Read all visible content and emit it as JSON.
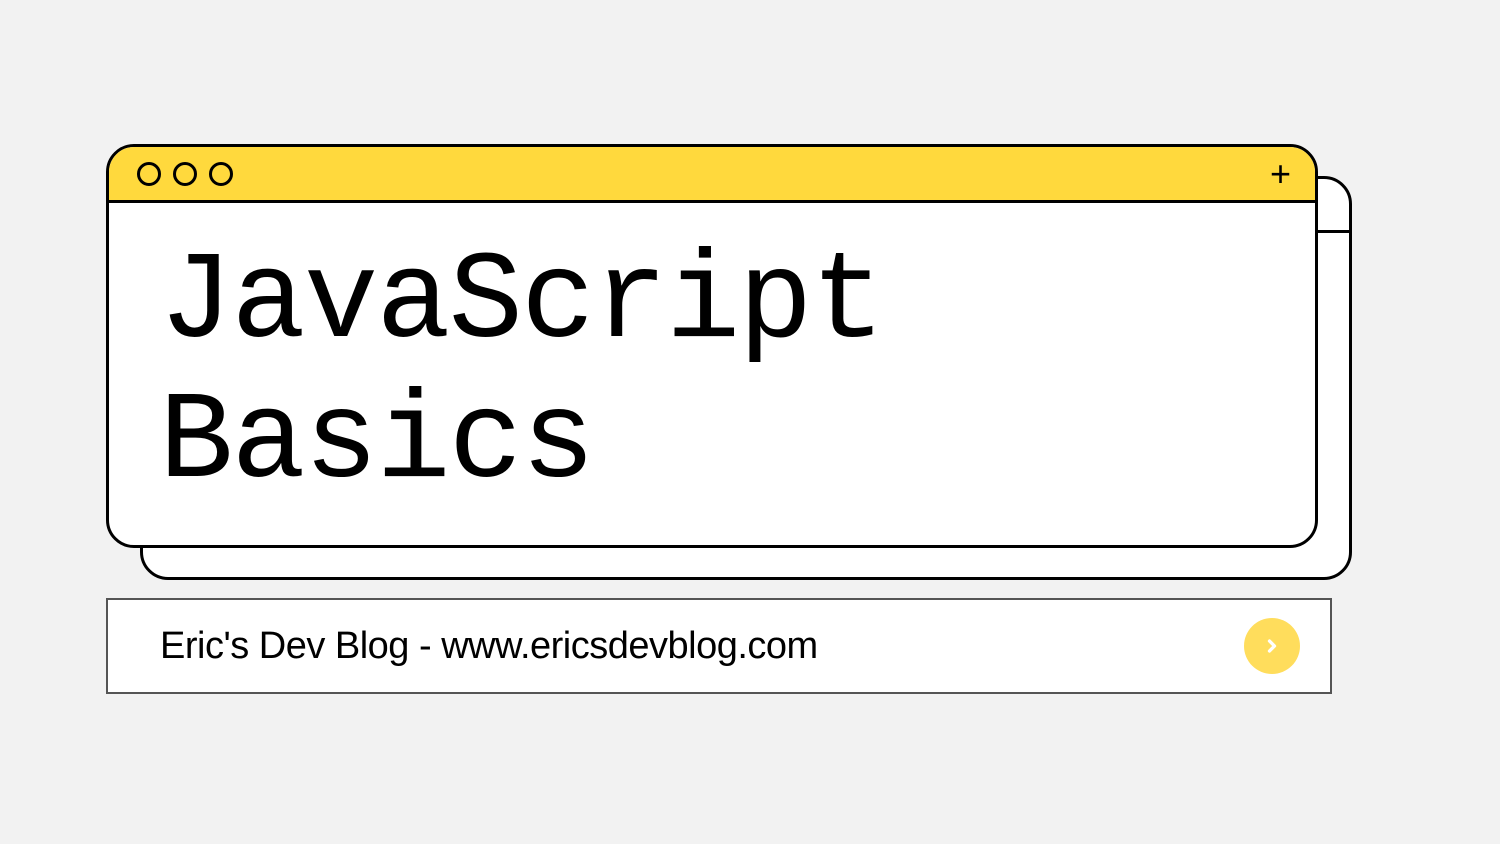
{
  "title": "JavaScript Basics",
  "addressBar": {
    "text": "Eric's Dev Blog - www.ericsdevblog.com"
  },
  "colors": {
    "headerBg": "#ffd93d",
    "pageBg": "#f2f2f2"
  }
}
